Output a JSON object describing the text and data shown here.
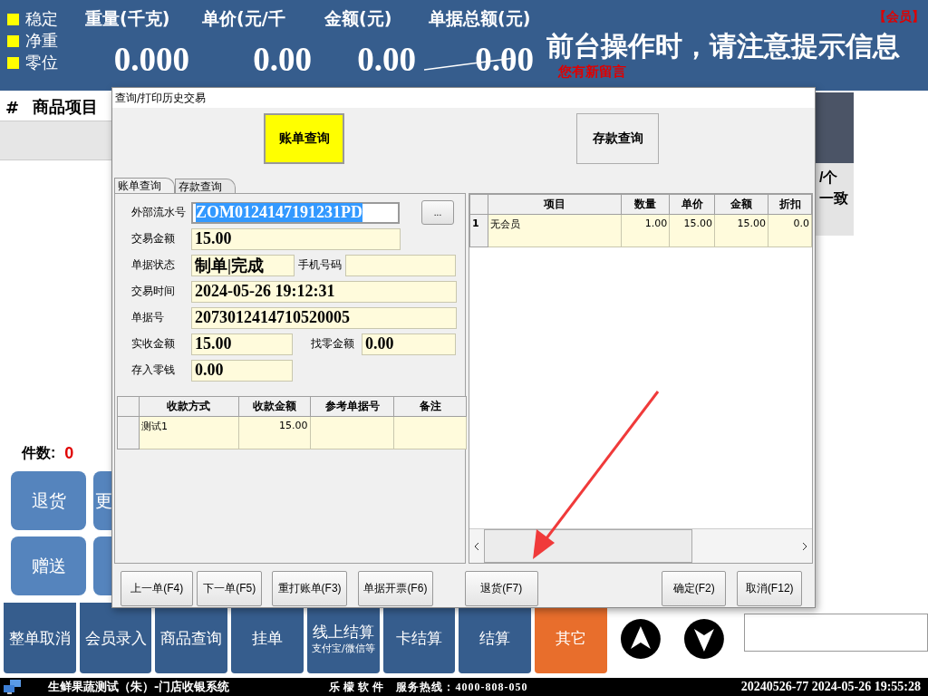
{
  "header": {
    "indicators": [
      {
        "label": "稳定",
        "on": true
      },
      {
        "label": "净重",
        "on": true
      },
      {
        "label": "零位",
        "on": true
      }
    ],
    "readouts": [
      {
        "label": "重量(千克)",
        "value": "0.000",
        "struck": false
      },
      {
        "label": "单价(元/千",
        "value": "0.00",
        "struck": false
      },
      {
        "label": "金额(元)",
        "value": "0.00",
        "struck": false
      },
      {
        "label": "单据总额(元)",
        "value": "0.00",
        "struck": true
      }
    ],
    "member_tag": "【会员】",
    "notice": "前台操作时，请注意提示信息",
    "message": "您有新留言"
  },
  "item_table": {
    "columns": [
      "#",
      "商品项目"
    ]
  },
  "side_panel": {
    "texts": [
      "/个",
      "一致"
    ]
  },
  "count": {
    "label": "件数:",
    "value": "0"
  },
  "quick_buttons": [
    {
      "kind": "text",
      "label": "退货"
    },
    {
      "kind": "partial",
      "label": "更"
    },
    {
      "kind": "text",
      "label": "赠送"
    },
    {
      "kind": "blank"
    }
  ],
  "function_buttons": [
    {
      "label": "整单取消",
      "highlighted": false
    },
    {
      "label": "会员录入",
      "highlighted": false
    },
    {
      "label": "商品查询",
      "highlighted": false
    },
    {
      "label": "挂单",
      "highlighted": false
    },
    {
      "label": "线上结算",
      "sublabel": "支付宝/微信等",
      "highlighted": false
    },
    {
      "label": "卡结算",
      "highlighted": false
    },
    {
      "label": "结算",
      "highlighted": false
    },
    {
      "label": "其它",
      "highlighted": true
    }
  ],
  "status_bar": {
    "title": "生鲜果蔬测试（朱）-门店收银系统",
    "brand": "乐檬软件",
    "hotline": "服务热线：4000-808-050",
    "datetime": "20240526-77 2024-05-26 19:55:28"
  },
  "dialog": {
    "title": "查询/打印历史交易",
    "mode_buttons": [
      {
        "label": "账单查询",
        "selected": true
      },
      {
        "label": "存款查询",
        "selected": false
      }
    ],
    "tabs": [
      {
        "label": "账单查询",
        "selected": true
      },
      {
        "label": "存款查询",
        "selected": false
      }
    ],
    "form_rows": [
      {
        "fields": [
          {
            "label": "外部流水号",
            "value": "ZOM0124147191231PD",
            "highlighted": true
          }
        ],
        "button": "..."
      },
      {
        "fields": [
          {
            "label": "交易金额",
            "value": "15.00",
            "highlighted": false
          }
        ]
      },
      {
        "fields": [
          {
            "label": "单据状态",
            "value": "制单|完成",
            "highlighted": false
          },
          {
            "label": "手机号码",
            "highlighted": false
          }
        ]
      },
      {
        "fields": [
          {
            "label": "交易时间",
            "value": "2024-05-26 19:12:31",
            "highlighted": false
          }
        ]
      },
      {
        "fields": [
          {
            "label": "单据号",
            "value": "2073012414710520005",
            "highlighted": false
          }
        ]
      },
      {
        "fields": [
          {
            "label": "实收金额",
            "value": "15.00",
            "highlighted": false
          },
          {
            "label": "找零金额",
            "value": "0.00",
            "highlighted": false
          }
        ]
      },
      {
        "fields": [
          {
            "label": "存入零钱",
            "value": "0.00",
            "highlighted": false
          }
        ]
      }
    ],
    "payment_table": {
      "columns": [
        "收款方式",
        "收款金额",
        "参考单据号",
        "备注"
      ],
      "rows": [
        [
          "测试1",
          "15.00"
        ]
      ]
    },
    "detail_table": {
      "columns": [
        "项目",
        "数量",
        "单价",
        "金额",
        "折扣"
      ],
      "rows": [
        {
          "number": "1",
          "cells": [
            "无会员",
            "1.00",
            "15.00",
            "15.00",
            "0.0"
          ]
        }
      ]
    },
    "footer_buttons": [
      "上一单(F4)",
      "下一单(F5)",
      "重打账单(F3)",
      "单据开票(F6)",
      "退货(F7)",
      "确定(F2)",
      "取消(F12)"
    ]
  }
}
